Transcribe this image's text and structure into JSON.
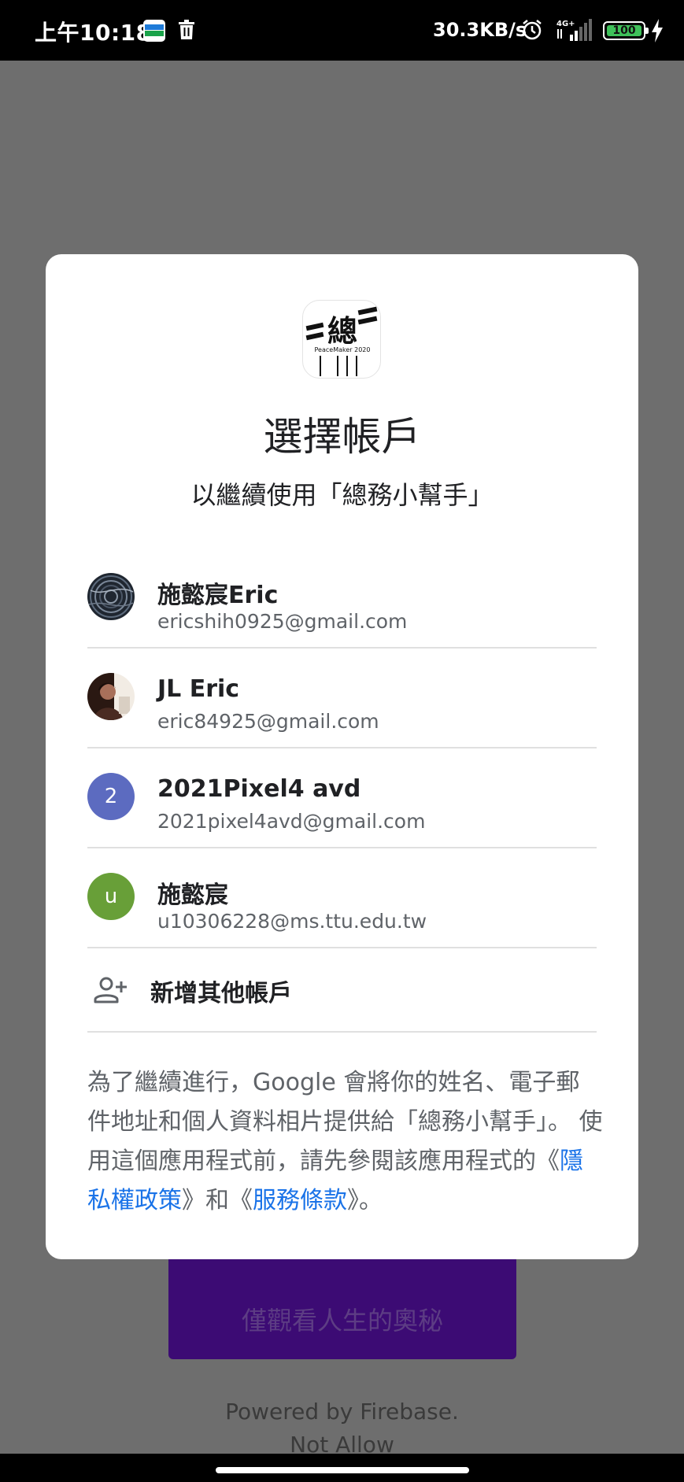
{
  "status_bar": {
    "time": "上午10:18",
    "net_speed": "30.3KB/s",
    "network_label": "4G+",
    "battery_level": "100",
    "icons": [
      "app-notification-icon",
      "trash-icon",
      "alarm-icon",
      "signal-icon",
      "battery-icon",
      "charging-icon"
    ]
  },
  "background_app": {
    "button_label": "僅觀看人生的奧秘",
    "powered_by": "Powered by Firebase.",
    "not_allow": "Not Allow"
  },
  "dialog": {
    "app_logo_text": "PeaceMaker 2020",
    "title": "選擇帳戶",
    "subtitle": "以繼續使用「總務小幫手」",
    "accounts": [
      {
        "name": "施懿宸Eric",
        "email": "ericshih0925@gmail.com",
        "avatar": "photo-dark"
      },
      {
        "name": "JL Eric",
        "email": "eric84925@gmail.com",
        "avatar": "photo-person"
      },
      {
        "name": "2021Pixel4 avd",
        "email": "2021pixel4avd@gmail.com",
        "avatar_letter": "2",
        "avatar_color": "#5c6bc0"
      },
      {
        "name": "施懿宸",
        "email": "u10306228@ms.ttu.edu.tw",
        "avatar_letter": "u",
        "avatar_color": "#689f38"
      }
    ],
    "add_account": "新增其他帳戶",
    "consent": {
      "part1": "為了繼續進行，Google 會將你的姓名、電子郵件地址和個人資料相片提供給「總務小幫手」。 使用這個應用程式前，請先參閱該應用程式的《",
      "privacy_link": "隱私權政策",
      "part2": "》和《",
      "terms_link": "服務條款",
      "part3": "》。"
    }
  }
}
